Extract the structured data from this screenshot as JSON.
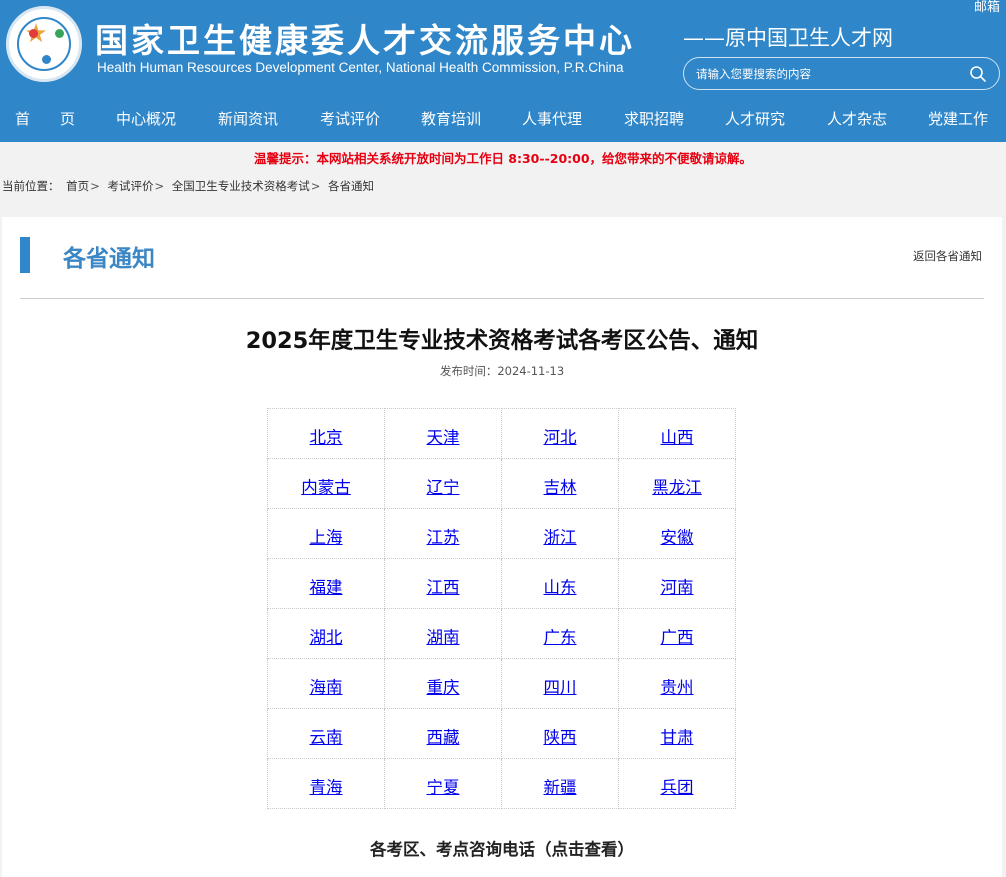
{
  "header": {
    "title_cn": "国家卫生健康委人才交流服务中心",
    "title_en": "Health Human Resources Development Center, National Health Commission, P.R.China",
    "subtitle": "——原中国卫生人才网",
    "mail_link": "邮箱",
    "search_placeholder": "请输入您要搜索的内容"
  },
  "nav": [
    "首　　页",
    "中心概况",
    "新闻资讯",
    "考试评价",
    "教育培训",
    "人事代理",
    "求职招聘",
    "人才研究",
    "人才杂志",
    "党建工作"
  ],
  "notice": "温馨提示：本网站相关系统开放时间为工作日 8:30--20:00，给您带来的不便敬请谅解。",
  "breadcrumb": {
    "label": "当前位置：",
    "items": [
      "首页",
      "考试评价",
      "全国卫生专业技术资格考试",
      "各省通知"
    ]
  },
  "section": {
    "title": "各省通知",
    "back_link": "返回各省通知"
  },
  "article": {
    "title": "2025年度卫生专业技术资格考试各考区公告、通知",
    "date": "发布时间：2024-11-13",
    "provinces": [
      [
        "北京",
        "天津",
        "河北",
        "山西"
      ],
      [
        "内蒙古",
        "辽宁",
        "吉林",
        "黑龙江"
      ],
      [
        "上海",
        "江苏",
        "浙江",
        "安徽"
      ],
      [
        "福建",
        "江西",
        "山东",
        "河南"
      ],
      [
        "湖北",
        "湖南",
        "广东",
        "广西"
      ],
      [
        "海南",
        "重庆",
        "四川",
        "贵州"
      ],
      [
        "云南",
        "西藏",
        "陕西",
        "甘肃"
      ],
      [
        "青海",
        "宁夏",
        "新疆",
        "兵团"
      ]
    ],
    "consult_link": "各考区、考点咨询电话（点击查看）"
  },
  "colors": {
    "brand_blue": "#2f86c8",
    "notice_red": "#e60012",
    "link_blue": "#0000ee"
  }
}
